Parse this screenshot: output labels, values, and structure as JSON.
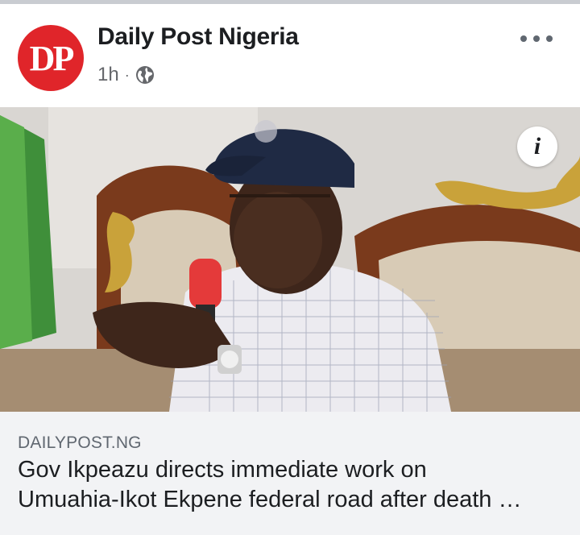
{
  "post": {
    "page_name": "Daily Post Nigeria",
    "avatar_text": "DP",
    "time": "1h",
    "separator": "·",
    "audience_icon": "globe-icon",
    "more_icon": "more-options-icon"
  },
  "image": {
    "description_icon": "info-icon",
    "info_label": "i"
  },
  "link": {
    "domain": "DAILYPOST.NG",
    "headline_line1": "Gov Ikpeazu directs immediate work on",
    "headline_line2": "Umuahia-Ikot Ekpene federal road after death …"
  },
  "colors": {
    "brand_red": "#e0252a",
    "text_primary": "#1c1e21",
    "text_secondary": "#65676b",
    "link_bg": "#f2f3f5"
  }
}
